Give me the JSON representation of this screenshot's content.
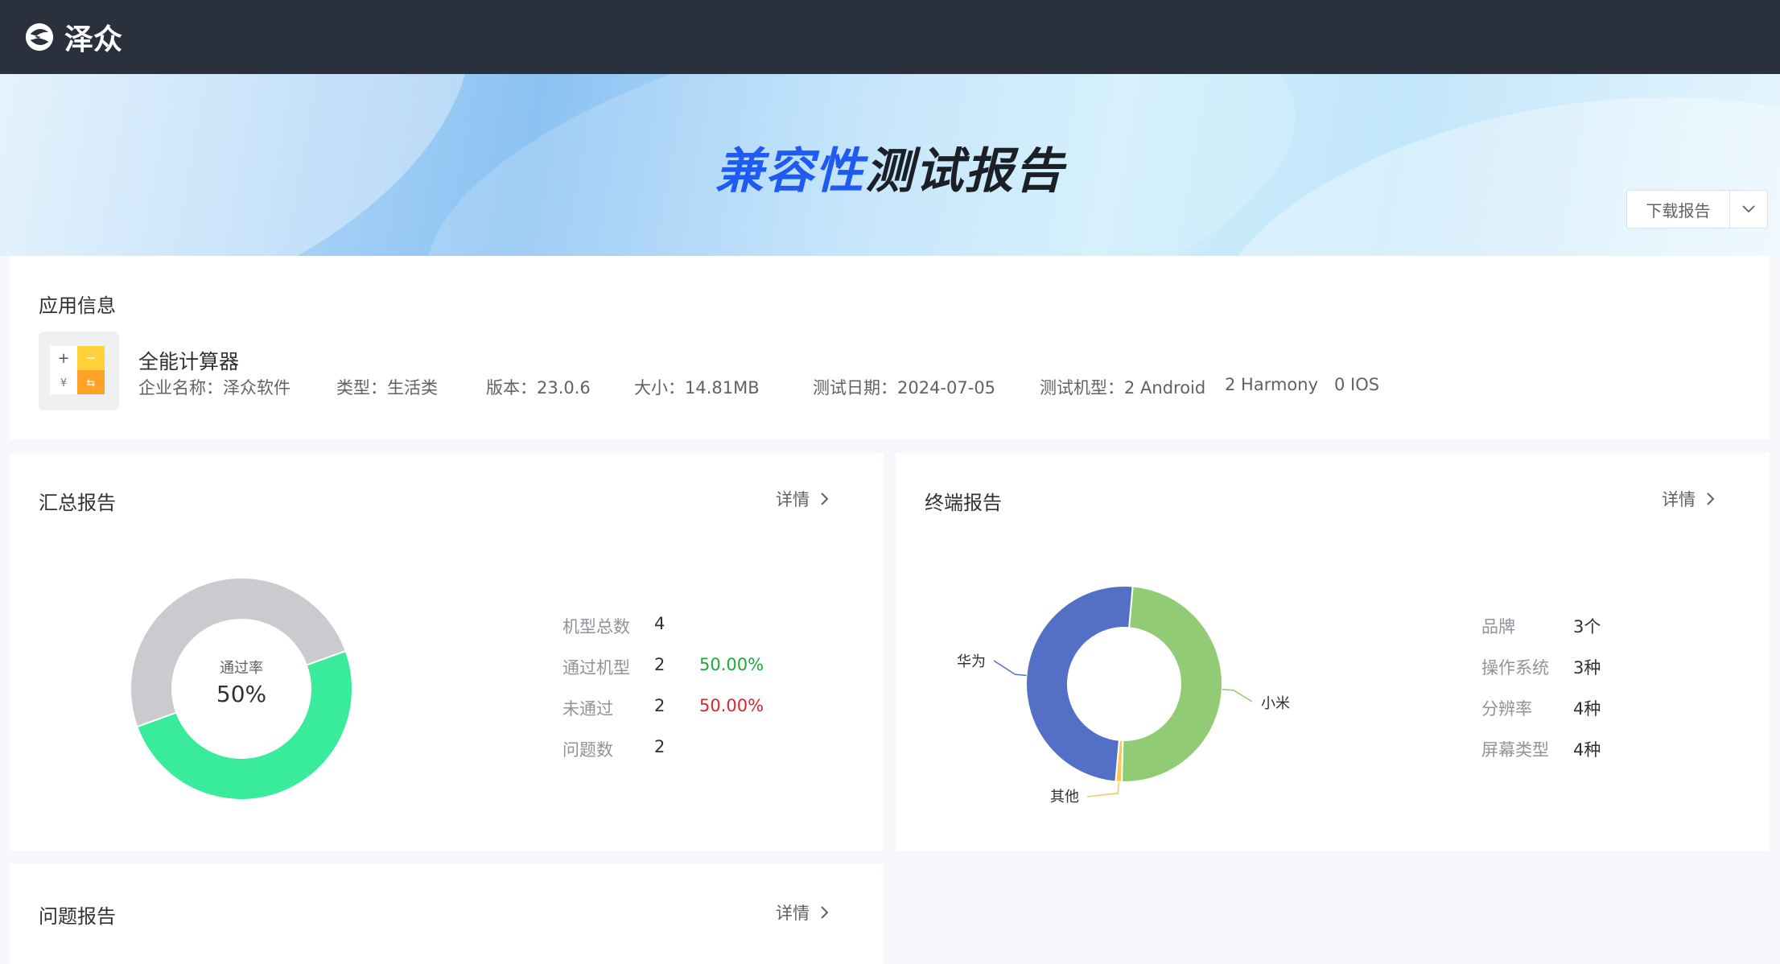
{
  "brand": {
    "name": "泽众"
  },
  "hero": {
    "title_highlight": "兼容性",
    "title_rest": "测试报告"
  },
  "download": {
    "label": "下载报告"
  },
  "app_info": {
    "section_title": "应用信息",
    "name": "全能计算器",
    "company": "企业名称：泽众软件",
    "type": "类型：生活类",
    "version": "版本：23.0.6",
    "size": "大小：14.81MB",
    "test_date": "测试日期：2024-07-05",
    "devices": "测试机型：2 Android",
    "harmony": "2 Harmony",
    "ios": "0 IOS"
  },
  "summary": {
    "section_title": "汇总报告",
    "detail_label": "详情",
    "center_title": "通过率",
    "center_value": "50%",
    "stats": [
      {
        "key": "机型总数",
        "value": "4",
        "pct": ""
      },
      {
        "key": "通过机型",
        "value": "2",
        "pct": "50.00%"
      },
      {
        "key": "未通过",
        "value": "2",
        "pct": "50.00%"
      },
      {
        "key": "问题数",
        "value": "2",
        "pct": ""
      }
    ]
  },
  "terminal": {
    "section_title": "终端报告",
    "detail_label": "详情",
    "labels": {
      "huawei": "华为",
      "xiaomi": "小米",
      "other": "其他"
    },
    "stats": [
      {
        "key": "品牌",
        "value": "3个"
      },
      {
        "key": "操作系统",
        "value": "3种"
      },
      {
        "key": "分辨率",
        "value": "4种"
      },
      {
        "key": "屏幕类型",
        "value": "4种"
      }
    ]
  },
  "issues": {
    "section_title": "问题报告",
    "detail_label": "详情"
  },
  "chart_data": [
    {
      "type": "pie",
      "title": "",
      "categories": [
        "通过",
        "未通过"
      ],
      "values": [
        50,
        50
      ],
      "colors": [
        "#38ec9c",
        "#cbcbcf"
      ]
    },
    {
      "type": "pie",
      "title": "",
      "categories": [
        "华为",
        "小米",
        "其他"
      ],
      "values": [
        50,
        49,
        1
      ],
      "colors": [
        "#5470c6",
        "#91cc75",
        "#fac858"
      ]
    }
  ],
  "colors": {
    "topbar": "#2b303d",
    "accent_blue": "#1f5bf0",
    "pass": "#1aab3b",
    "fail": "#d9262c"
  }
}
